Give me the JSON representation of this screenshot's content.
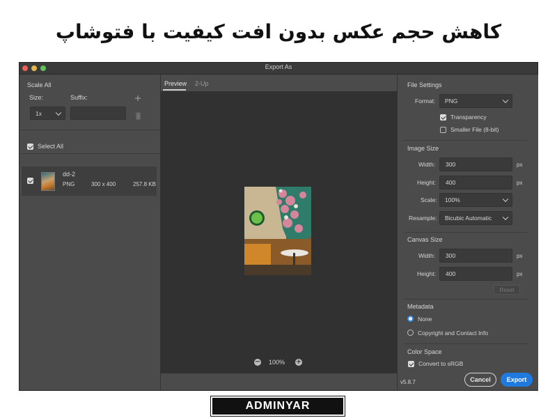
{
  "banner": {
    "title": "کاهش حجم عکس بدون افت کیفیت با فتوشاپ"
  },
  "window": {
    "title": "Export As"
  },
  "left_panel": {
    "scale_all": "Scale All",
    "size_label": "Size:",
    "suffix_label": "Suffix:",
    "scale_value": "1x",
    "suffix_value": "",
    "add_icon": "plus-icon",
    "delete_icon": "trash-icon",
    "select_all": "Select All",
    "asset": {
      "name": "dd-2",
      "format": "PNG",
      "dimensions": "300 x 400",
      "size": "257.8 KB"
    }
  },
  "center": {
    "tabs": [
      {
        "label": "Preview"
      },
      {
        "label": "2-Up"
      }
    ],
    "zoom": "100%",
    "zoom_out_icon": "zoom-out-icon",
    "zoom_in_icon": "zoom-in-icon"
  },
  "right_panel": {
    "file_settings": {
      "heading": "File Settings",
      "format_label": "Format:",
      "format_value": "PNG",
      "transparency": "Transparency",
      "smaller_file": "Smaller File (8-bit)"
    },
    "image_size": {
      "heading": "Image Size",
      "width_label": "Width:",
      "width_value": "300",
      "height_label": "Height:",
      "height_value": "400",
      "unit": "px",
      "scale_label": "Scale:",
      "scale_value": "100%",
      "resample_label": "Resample:",
      "resample_value": "Bicubic Automatic"
    },
    "canvas_size": {
      "heading": "Canvas Size",
      "width_label": "Width:",
      "width_value": "300",
      "height_label": "Height:",
      "height_value": "400",
      "unit": "px",
      "reset": "Reset"
    },
    "metadata": {
      "heading": "Metadata",
      "none": "None",
      "copyright": "Copyright and Contact Info"
    },
    "color_space": {
      "heading": "Color Space",
      "convert": "Convert to sRGB"
    }
  },
  "footer": {
    "version": "v5.8.7",
    "cancel": "Cancel",
    "export": "Export"
  },
  "watermark": "ADMINYAR",
  "colors": {
    "accent": "#1f7ae0",
    "panel": "#4b4b4b",
    "preview_bg": "#313131"
  }
}
